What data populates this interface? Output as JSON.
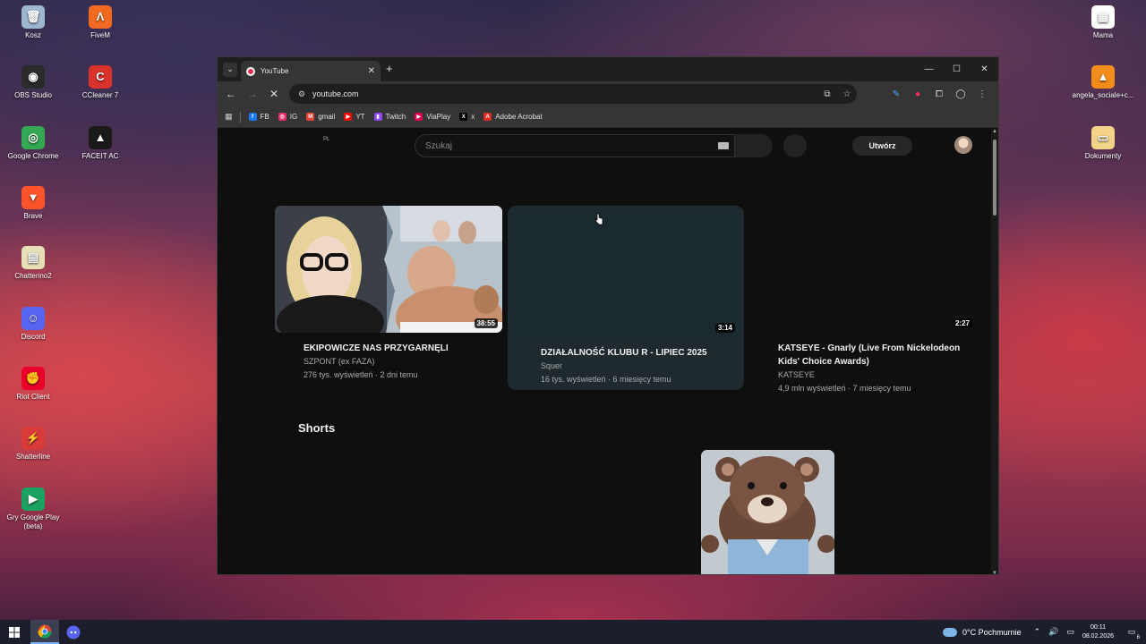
{
  "desktop": {
    "icons_left_col1": [
      {
        "label": "Kosz",
        "icon": "recycle-bin-icon",
        "color": "#9fb6cf",
        "glyph": "🗑"
      },
      {
        "label": "OBS Studio",
        "icon": "obs-icon",
        "color": "#2b2b2b",
        "glyph": "◉"
      },
      {
        "label": "Google Chrome",
        "icon": "chrome-icon",
        "color": "#34a853",
        "glyph": "◎"
      },
      {
        "label": "Brave",
        "icon": "brave-icon",
        "color": "#fb542b",
        "glyph": "▼"
      },
      {
        "label": "Chatterino2",
        "icon": "chatterino-icon",
        "color": "#e6dfb8",
        "glyph": "▤"
      },
      {
        "label": "Discord",
        "icon": "discord-icon",
        "color": "#5865f2",
        "glyph": "☺"
      },
      {
        "label": "Riot Client",
        "icon": "riot-icon",
        "color": "#eb0029",
        "glyph": "✊"
      },
      {
        "label": "Shatterline",
        "icon": "shatterline-icon",
        "color": "#d93a3a",
        "glyph": "⚡"
      },
      {
        "label": "Gry Google Play (beta)",
        "icon": "google-play-games-icon",
        "color": "#1aa260",
        "glyph": "▶"
      }
    ],
    "icons_left_col2": [
      {
        "label": "FiveM",
        "icon": "fivem-icon",
        "color": "#f26a21",
        "glyph": "Λ"
      },
      {
        "label": "CCleaner 7",
        "icon": "ccleaner-icon",
        "color": "#d9322a",
        "glyph": "C"
      },
      {
        "label": "FACEIT AC",
        "icon": "faceit-icon",
        "color": "#1a1a1a",
        "glyph": "▲"
      }
    ],
    "icons_right": [
      {
        "label": "Mama",
        "icon": "pdf-file-icon",
        "color": "#ffffff",
        "glyph": "▦"
      },
      {
        "label": "angela_sociale+c...",
        "icon": "vlc-icon",
        "color": "#f28c1a",
        "glyph": "▲"
      },
      {
        "label": "Dokumenty",
        "icon": "folder-icon",
        "color": "#f3d38a",
        "glyph": "▭"
      }
    ]
  },
  "browser": {
    "tab_title": "YouTube",
    "url": "youtube.com",
    "bookmarks": [
      {
        "label": "FB",
        "icon": "facebook-icon",
        "color": "#1877f2",
        "glyph": "f"
      },
      {
        "label": "IG",
        "icon": "instagram-icon",
        "color": "#e1306c",
        "glyph": "◎"
      },
      {
        "label": "gmail",
        "icon": "gmail-icon",
        "color": "#ea4335",
        "glyph": "M"
      },
      {
        "label": "YT",
        "icon": "youtube-icon",
        "color": "#ff0000",
        "glyph": "▶"
      },
      {
        "label": "Twitch",
        "icon": "twitch-icon",
        "color": "#9146ff",
        "glyph": "▮"
      },
      {
        "label": "ViaPlay",
        "icon": "viaplay-icon",
        "color": "#e3004b",
        "glyph": "▶"
      },
      {
        "label": "x",
        "icon": "x-icon",
        "color": "#000000",
        "glyph": "X"
      },
      {
        "label": "Adobe Acrobat",
        "icon": "acrobat-icon",
        "color": "#e02d22",
        "glyph": "A"
      }
    ]
  },
  "youtube": {
    "country_code": "PL",
    "search_placeholder": "Szukaj",
    "create_label": "Utwórz",
    "videos": [
      {
        "title": "EKIPOWICZE NAS PRZYGARNĘLI",
        "channel": "SZPONT (ex FAZA)",
        "meta": "276 tys. wyświetleń · 2 dni temu",
        "duration": "38:55"
      },
      {
        "title": "DZIAŁALNOŚĆ KLUBU R - LIPIEC 2025",
        "channel": "Squer",
        "meta": "16 tys. wyświetleń · 6 miesięcy temu",
        "duration": "3:14"
      },
      {
        "title": "KATSEYE - Gnarly (Live From Nickelodeon Kids' Choice Awards)",
        "channel": "KATSEYE",
        "meta": "4,9 mln wyświetleń · 7 miesięcy temu",
        "duration": "2:27"
      }
    ],
    "shorts_heading": "Shorts"
  },
  "taskbar": {
    "weather": "0°C  Pochmurnie",
    "time": "00:11",
    "date": "08.02.2026",
    "notification_count": "6"
  }
}
